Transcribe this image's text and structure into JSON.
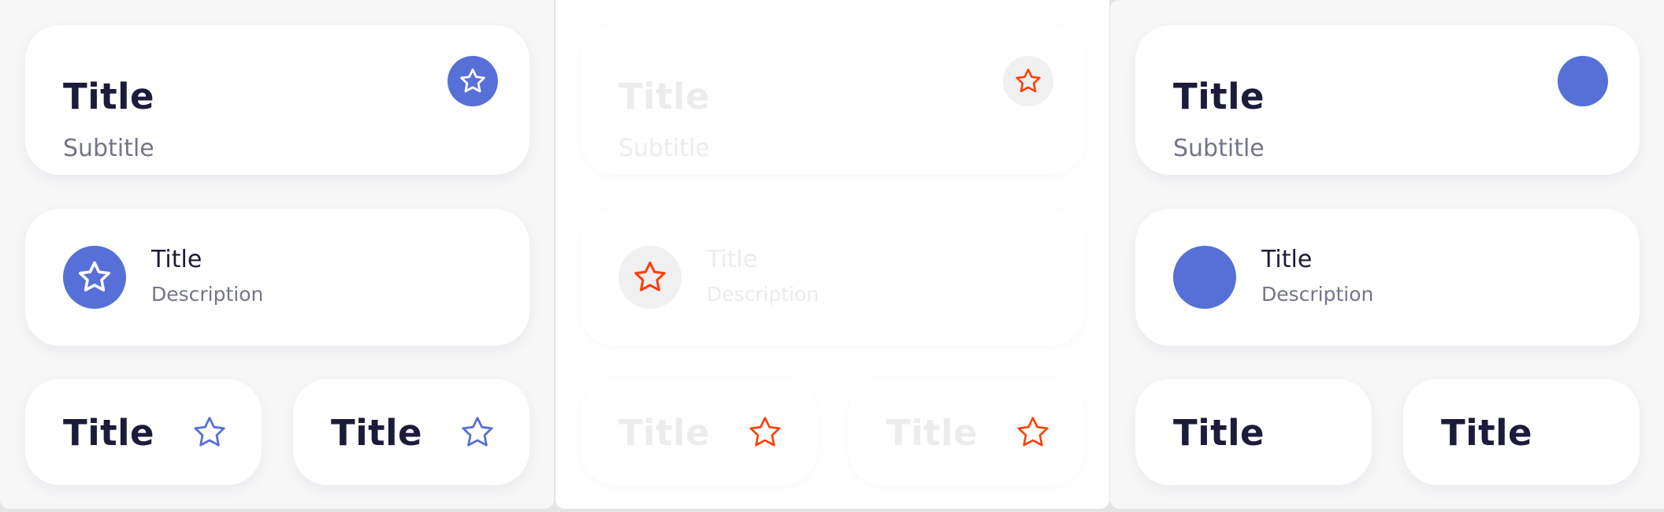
{
  "colors": {
    "accent": "#5670d8",
    "star_orange": "#ff3d00",
    "text_dark": "#1b1c3a",
    "text_muted": "#737589",
    "text_disabled": "#ececee"
  },
  "columns": [
    {
      "state": "default",
      "big_card": {
        "title": "Title",
        "subtitle": "Subtitle",
        "icon": "star-icon"
      },
      "list_item": {
        "title": "Title",
        "description": "Description",
        "icon": "star-icon"
      },
      "small_cards": [
        {
          "title": "Title",
          "icon": "star-icon"
        },
        {
          "title": "Title",
          "icon": "star-icon"
        }
      ]
    },
    {
      "state": "disabled",
      "big_card": {
        "title": "Title",
        "subtitle": "Subtitle",
        "icon": "star-icon"
      },
      "list_item": {
        "title": "Title",
        "description": "Description",
        "icon": "star-icon"
      },
      "small_cards": [
        {
          "title": "Title",
          "icon": "star-icon"
        },
        {
          "title": "Title",
          "icon": "star-icon"
        }
      ]
    },
    {
      "state": "no-icon",
      "big_card": {
        "title": "Title",
        "subtitle": "Subtitle"
      },
      "list_item": {
        "title": "Title",
        "description": "Description"
      },
      "small_cards": [
        {
          "title": "Title"
        },
        {
          "title": "Title"
        }
      ]
    }
  ]
}
